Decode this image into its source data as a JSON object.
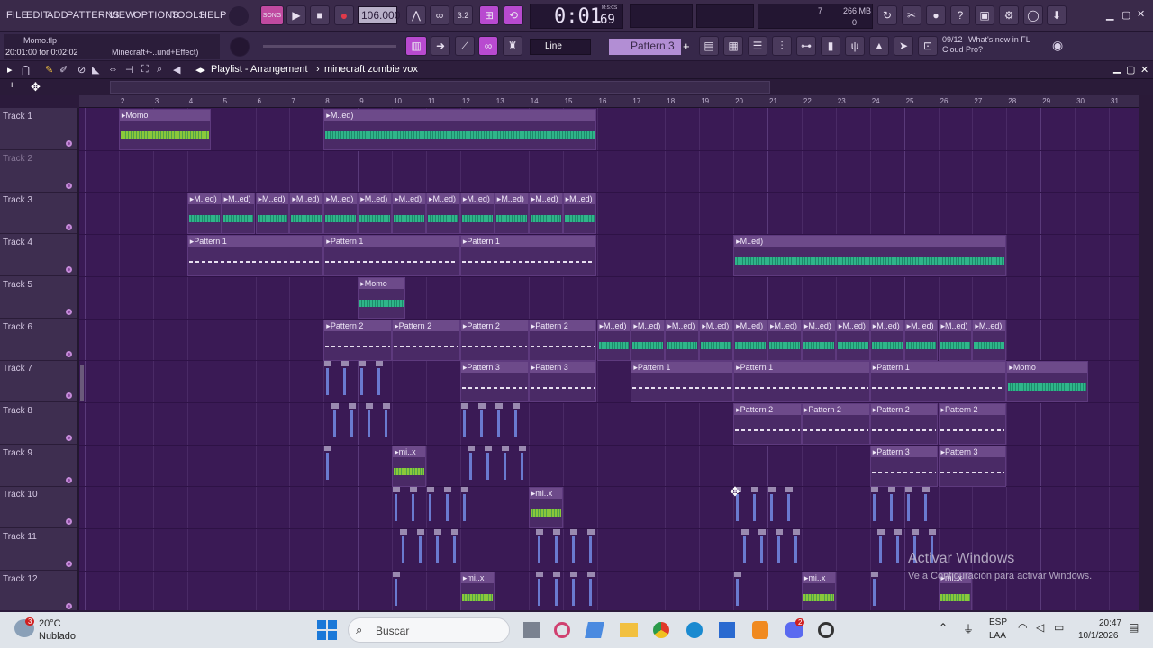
{
  "menu": [
    "FILE",
    "EDIT",
    "ADD",
    "PATTERNS",
    "VIEW",
    "OPTIONS",
    "TOOLS",
    "HELP"
  ],
  "transport": {
    "mode": "SONG",
    "tempo": "106.000",
    "time": "0:01",
    "time_frac": "69",
    "time_unit": "M:S:CS"
  },
  "monitor": {
    "cpu": "7",
    "mem": "266 MB",
    "poly": "0"
  },
  "project": {
    "file": "Momo.flp",
    "time_info": "20:01:00 for 0:02:02",
    "hint": "Minecraft+-..und+Effect)"
  },
  "snap": "Line",
  "pattern_select": "Pattern 3",
  "news": {
    "count": "09/12",
    "text1": "What's new in FL",
    "text2": "Cloud Pro?"
  },
  "playlist": {
    "title": "Playlist - Arrangement",
    "sep": "›",
    "arrangement": "minecraft zombie vox"
  },
  "ruler": [
    "2",
    "3",
    "4",
    "5",
    "6",
    "7",
    "8",
    "9",
    "10",
    "11",
    "12",
    "13",
    "14",
    "15",
    "16",
    "17",
    "18",
    "19",
    "20",
    "21",
    "22",
    "23",
    "24",
    "25",
    "26",
    "27",
    "28",
    "29",
    "30",
    "31"
  ],
  "tracks": [
    "Track 1",
    "Track 2",
    "Track 3",
    "Track 4",
    "Track 5",
    "Track 6",
    "Track 7",
    "Track 8",
    "Track 9",
    "Track 10",
    "Track 11",
    "Track 12"
  ],
  "clip_labels": {
    "momo": "Momo",
    "pat1": "Pattern 1",
    "pat2": "Pattern 2",
    "pat3": "Pattern 3",
    "med": "M..ed)",
    "mix": "mi..x"
  },
  "watermark": {
    "title": "Activar Windows",
    "sub": "Ve a Configuración para activar Windows."
  },
  "taskbar": {
    "temp": "20°C",
    "weather": "Nublado",
    "badge": "3",
    "search": "Buscar",
    "lang1": "ESP",
    "lang2": "LAA",
    "time": "20:47",
    "date": "10/1/2026",
    "discord_badge": "2"
  }
}
